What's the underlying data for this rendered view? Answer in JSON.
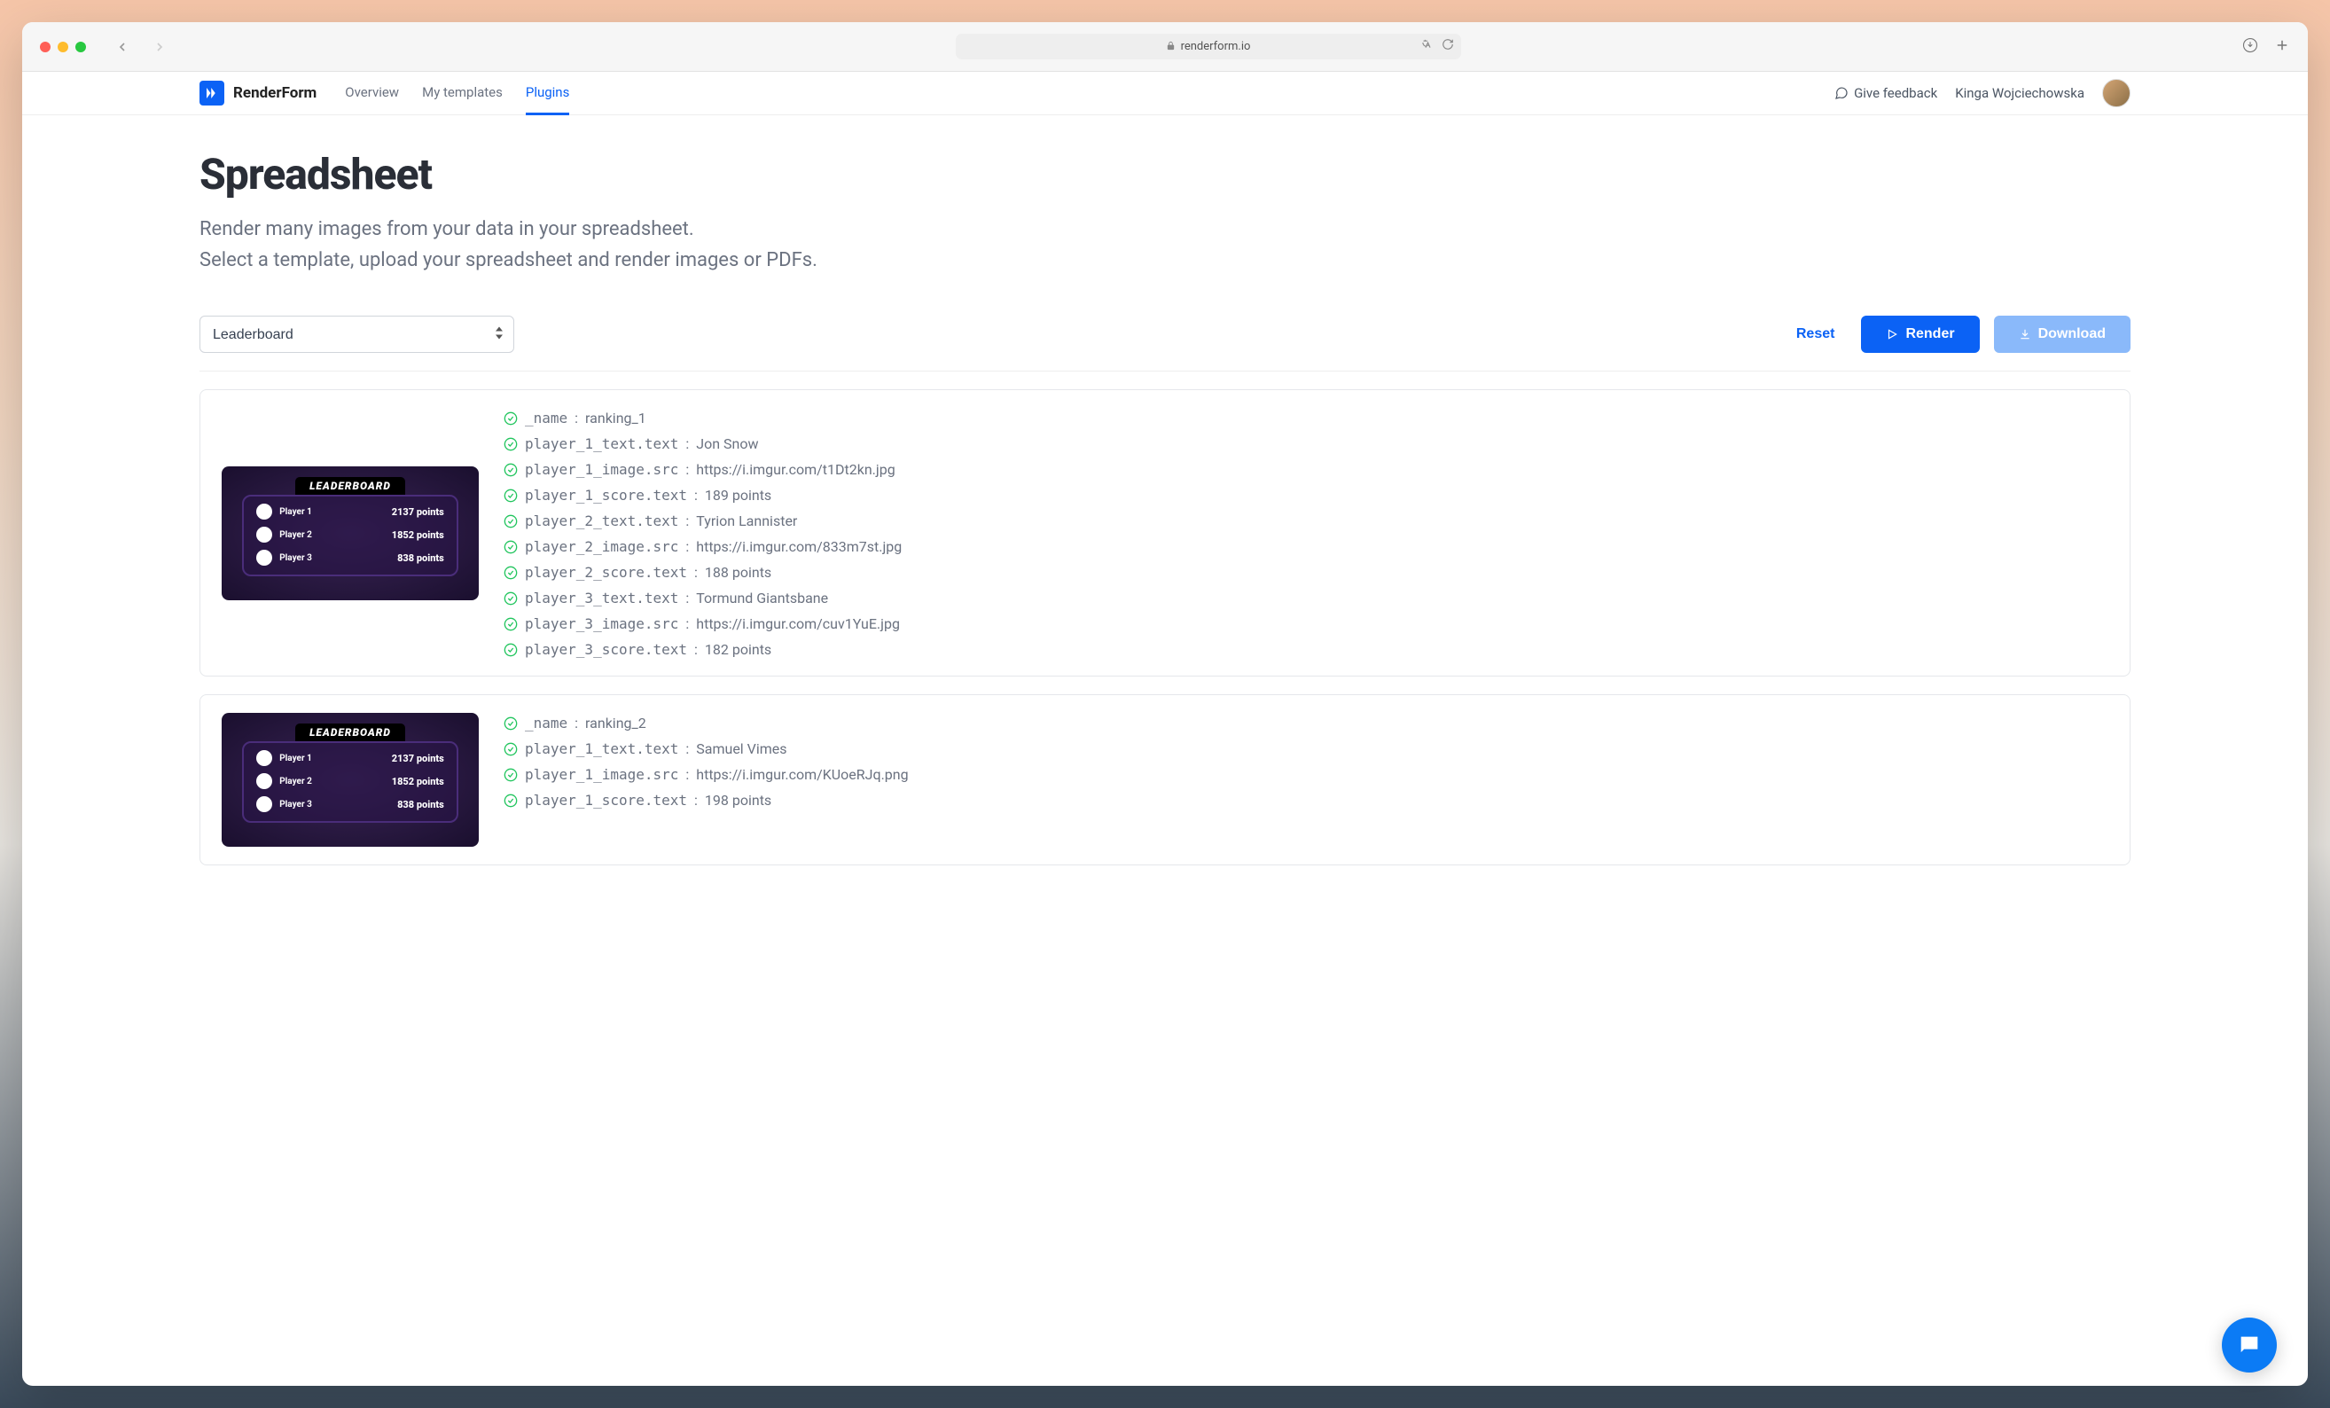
{
  "browser": {
    "url_host": "renderform.io"
  },
  "nav": {
    "brand": "RenderForm",
    "links": [
      "Overview",
      "My templates",
      "Plugins"
    ],
    "active_index": 2,
    "feedback": "Give feedback",
    "username": "Kinga Wojciechowska"
  },
  "page": {
    "title": "Spreadsheet",
    "desc_line_1": "Render many images from your data in your spreadsheet.",
    "desc_line_2": "Select a template, upload your spreadsheet and render images or PDFs."
  },
  "controls": {
    "template_selected": "Leaderboard",
    "reset": "Reset",
    "render": "Render",
    "download": "Download"
  },
  "preview": {
    "title": "LEADERBOARD",
    "rows": [
      {
        "name": "Player 1",
        "score": "2137 points"
      },
      {
        "name": "Player 2",
        "score": "1852 points"
      },
      {
        "name": "Player 3",
        "score": "838 points"
      }
    ]
  },
  "cards": [
    {
      "fields": [
        {
          "key": "_name",
          "value": "ranking_1"
        },
        {
          "key": "player_1_text.text",
          "value": "Jon Snow"
        },
        {
          "key": "player_1_image.src",
          "value": "https://i.imgur.com/t1Dt2kn.jpg"
        },
        {
          "key": "player_1_score.text",
          "value": "189 points"
        },
        {
          "key": "player_2_text.text",
          "value": "Tyrion Lannister"
        },
        {
          "key": "player_2_image.src",
          "value": "https://i.imgur.com/833m7st.jpg"
        },
        {
          "key": "player_2_score.text",
          "value": "188 points"
        },
        {
          "key": "player_3_text.text",
          "value": "Tormund Giantsbane"
        },
        {
          "key": "player_3_image.src",
          "value": "https://i.imgur.com/cuv1YuE.jpg"
        },
        {
          "key": "player_3_score.text",
          "value": "182 points"
        }
      ]
    },
    {
      "fields": [
        {
          "key": "_name",
          "value": "ranking_2"
        },
        {
          "key": "player_1_text.text",
          "value": "Samuel Vimes"
        },
        {
          "key": "player_1_image.src",
          "value": "https://i.imgur.com/KUoeRJq.png"
        },
        {
          "key": "player_1_score.text",
          "value": "198 points"
        }
      ]
    }
  ]
}
